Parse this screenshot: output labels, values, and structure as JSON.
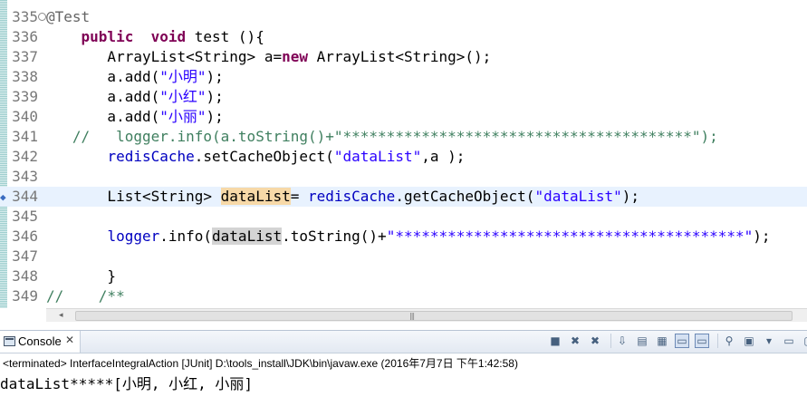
{
  "editor": {
    "lines": [
      {
        "num": "335",
        "fold": "⊖",
        "parts": [
          {
            "t": "@Test",
            "c": "ann"
          }
        ]
      },
      {
        "num": "336",
        "parts": [
          {
            "t": "    "
          },
          {
            "t": "public",
            "c": "kw"
          },
          {
            "t": "  "
          },
          {
            "t": "void",
            "c": "kw"
          },
          {
            "t": " test (){"
          }
        ]
      },
      {
        "num": "337",
        "parts": [
          {
            "t": "       ArrayList<String> a="
          },
          {
            "t": "new",
            "c": "kw"
          },
          {
            "t": " ArrayList<String>();"
          }
        ]
      },
      {
        "num": "338",
        "parts": [
          {
            "t": "       a.add("
          },
          {
            "t": "\"小明\"",
            "c": "str"
          },
          {
            "t": ");"
          }
        ]
      },
      {
        "num": "339",
        "parts": [
          {
            "t": "       a.add("
          },
          {
            "t": "\"小红\"",
            "c": "str"
          },
          {
            "t": ");"
          }
        ]
      },
      {
        "num": "340",
        "parts": [
          {
            "t": "       a.add("
          },
          {
            "t": "\"小丽\"",
            "c": "str"
          },
          {
            "t": ");"
          }
        ]
      },
      {
        "num": "341",
        "parts": [
          {
            "t": "   //   logger.info(a.toString()+\"****************************************\");",
            "c": "cmt"
          }
        ]
      },
      {
        "num": "342",
        "parts": [
          {
            "t": "       "
          },
          {
            "t": "redisCache",
            "c": "fld"
          },
          {
            "t": ".setCacheObject("
          },
          {
            "t": "\"dataList\"",
            "c": "str"
          },
          {
            "t": ",a );"
          }
        ]
      },
      {
        "num": "343",
        "parts": []
      },
      {
        "num": "344",
        "current": true,
        "marker": "◆",
        "parts": [
          {
            "t": "       List<String> "
          },
          {
            "t": "dataList",
            "c": "hlw"
          },
          {
            "t": "= "
          },
          {
            "t": "redisCache",
            "c": "fld"
          },
          {
            "t": ".getCacheObject("
          },
          {
            "t": "\"dataList\"",
            "c": "str"
          },
          {
            "t": ");"
          }
        ]
      },
      {
        "num": "345",
        "parts": []
      },
      {
        "num": "346",
        "parts": [
          {
            "t": "       "
          },
          {
            "t": "logger",
            "c": "fld"
          },
          {
            "t": ".info("
          },
          {
            "t": "dataList",
            "c": "hlr"
          },
          {
            "t": ".toString()+"
          },
          {
            "t": "\"****************************************\"",
            "c": "str"
          },
          {
            "t": ");"
          }
        ]
      },
      {
        "num": "347",
        "parts": []
      },
      {
        "num": "348",
        "parts": [
          {
            "t": "       }"
          }
        ]
      },
      {
        "num": "349",
        "parts": [
          {
            "t": "//    /**",
            "c": "cmt"
          }
        ]
      }
    ],
    "scroll_left_arrow": "◂",
    "scroll_grip": "|||"
  },
  "console": {
    "tab_title": "Console",
    "close_glyph": "✕",
    "status": "<terminated> InterfaceIntegralAction [JUnit] D:\\tools_install\\JDK\\bin\\javaw.exe (2016年7月7日 下午1:42:58)",
    "output": "dataList*****[小明, 小红, 小丽]",
    "toolbar": [
      {
        "name": "terminate-icon",
        "glyph": "■"
      },
      {
        "name": "remove-launch-icon",
        "glyph": "✖"
      },
      {
        "name": "remove-all-terminated-icon",
        "glyph": "✖"
      },
      {
        "name": "sep"
      },
      {
        "name": "scroll-lock-icon",
        "glyph": "⇩"
      },
      {
        "name": "clear-console-icon",
        "glyph": "▤"
      },
      {
        "name": "word-wrap-icon",
        "glyph": "▦"
      },
      {
        "name": "show-when-stdout-icon",
        "glyph": "▭",
        "pressed": true
      },
      {
        "name": "show-when-stderr-icon",
        "glyph": "▭",
        "pressed": true
      },
      {
        "name": "sep"
      },
      {
        "name": "pin-console-icon",
        "glyph": "⚲"
      },
      {
        "name": "display-console-icon",
        "glyph": "▣"
      },
      {
        "name": "view-menu-icon",
        "glyph": "▾"
      },
      {
        "name": "minimize-icon",
        "glyph": "▭"
      },
      {
        "name": "maximize-icon",
        "glyph": "▢"
      }
    ]
  }
}
